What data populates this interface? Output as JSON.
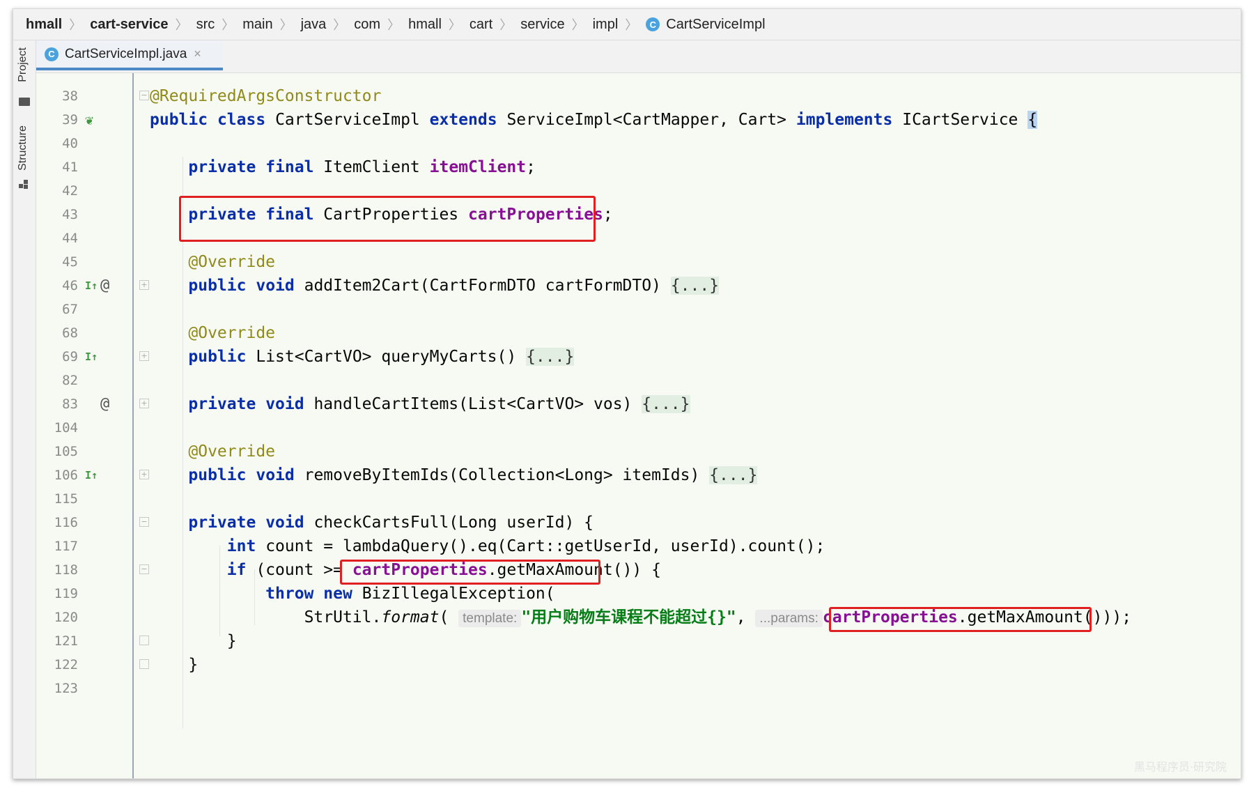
{
  "breadcrumb": [
    "hmall",
    "cart-service",
    "src",
    "main",
    "java",
    "com",
    "hmall",
    "cart",
    "service",
    "impl",
    "CartServiceImpl"
  ],
  "breadcrumb_class_icon": "C",
  "tool_window_left": {
    "project": "Project",
    "structure": "Structure"
  },
  "tab": {
    "icon": "C",
    "label": "CartServiceImpl.java",
    "close": "×"
  },
  "gutter": {
    "ln38": "38",
    "ln39": "39",
    "ln40": "40",
    "ln41": "41",
    "ln42": "42",
    "ln43": "43",
    "ln44": "44",
    "ln45": "45",
    "ln46": "46",
    "ln67": "67",
    "ln68": "68",
    "ln69": "69",
    "ln82": "82",
    "ln83": "83",
    "ln104": "104",
    "ln105": "105",
    "ln106": "106",
    "ln115": "115",
    "ln116": "116",
    "ln117": "117",
    "ln118": "118",
    "ln119": "119",
    "ln120": "120",
    "ln121": "121",
    "ln122": "122",
    "ln123": "123"
  },
  "code": {
    "l38_annotation": "@RequiredArgsConstructor",
    "l39_public": "public",
    "l39_class": "class",
    "l39_name": "CartServiceImpl",
    "l39_extends": "extends",
    "l39_super": "ServiceImpl<CartMapper, Cart>",
    "l39_implements": "implements",
    "l39_iface": "ICartService",
    "l39_brace": "{",
    "l41_private": "private",
    "l41_final": "final",
    "l41_type": "ItemClient",
    "l41_field": "itemClient",
    "l41_end": ";",
    "l43_private": "private",
    "l43_final": "final",
    "l43_type": "CartProperties",
    "l43_field": "cartProperties",
    "l43_end": ";",
    "l45_annotation": "@Override",
    "l46_public": "public",
    "l46_void": "void",
    "l46_sig": "addItem2Cart(CartFormDTO cartFormDTO)",
    "l46_folded": "{...}",
    "l68_annotation": "@Override",
    "l69_public": "public",
    "l69_sig": "List<CartVO> queryMyCarts()",
    "l69_folded": "{...}",
    "l83_private": "private",
    "l83_void": "void",
    "l83_sig": "handleCartItems(List<CartVO> vos)",
    "l83_folded": "{...}",
    "l105_annotation": "@Override",
    "l106_public": "public",
    "l106_void": "void",
    "l106_sig": "removeByItemIds(Collection<Long> itemIds)",
    "l106_folded": "{...}",
    "l116_private": "private",
    "l116_void": "void",
    "l116_sig": "checkCartsFull(Long userId) {",
    "l117_int": "int",
    "l117_rest": "count = lambdaQuery().eq(Cart::getUserId, userId).count();",
    "l118_if": "if",
    "l118_pre": "(count >=",
    "l118_field": "cartProperties",
    "l118_call": ".getMaxAmount()",
    "l118_post": ") {",
    "l119_throw": "throw",
    "l119_new": "new",
    "l119_rest": "BizIllegalException(",
    "l120_util": "StrUtil.",
    "l120_format": "format",
    "l120_open": "(",
    "l120_hint_template": "template:",
    "l120_string": "\"用户购物车课程不能超过{}\"",
    "l120_comma": ",",
    "l120_hint_params": "...params:",
    "l120_field": "cartProperties",
    "l120_call": ".getMaxAmount()",
    "l120_close": "));",
    "l121_brace": "}",
    "l122_brace": "}"
  },
  "watermark": "黑马程序员·研究院"
}
